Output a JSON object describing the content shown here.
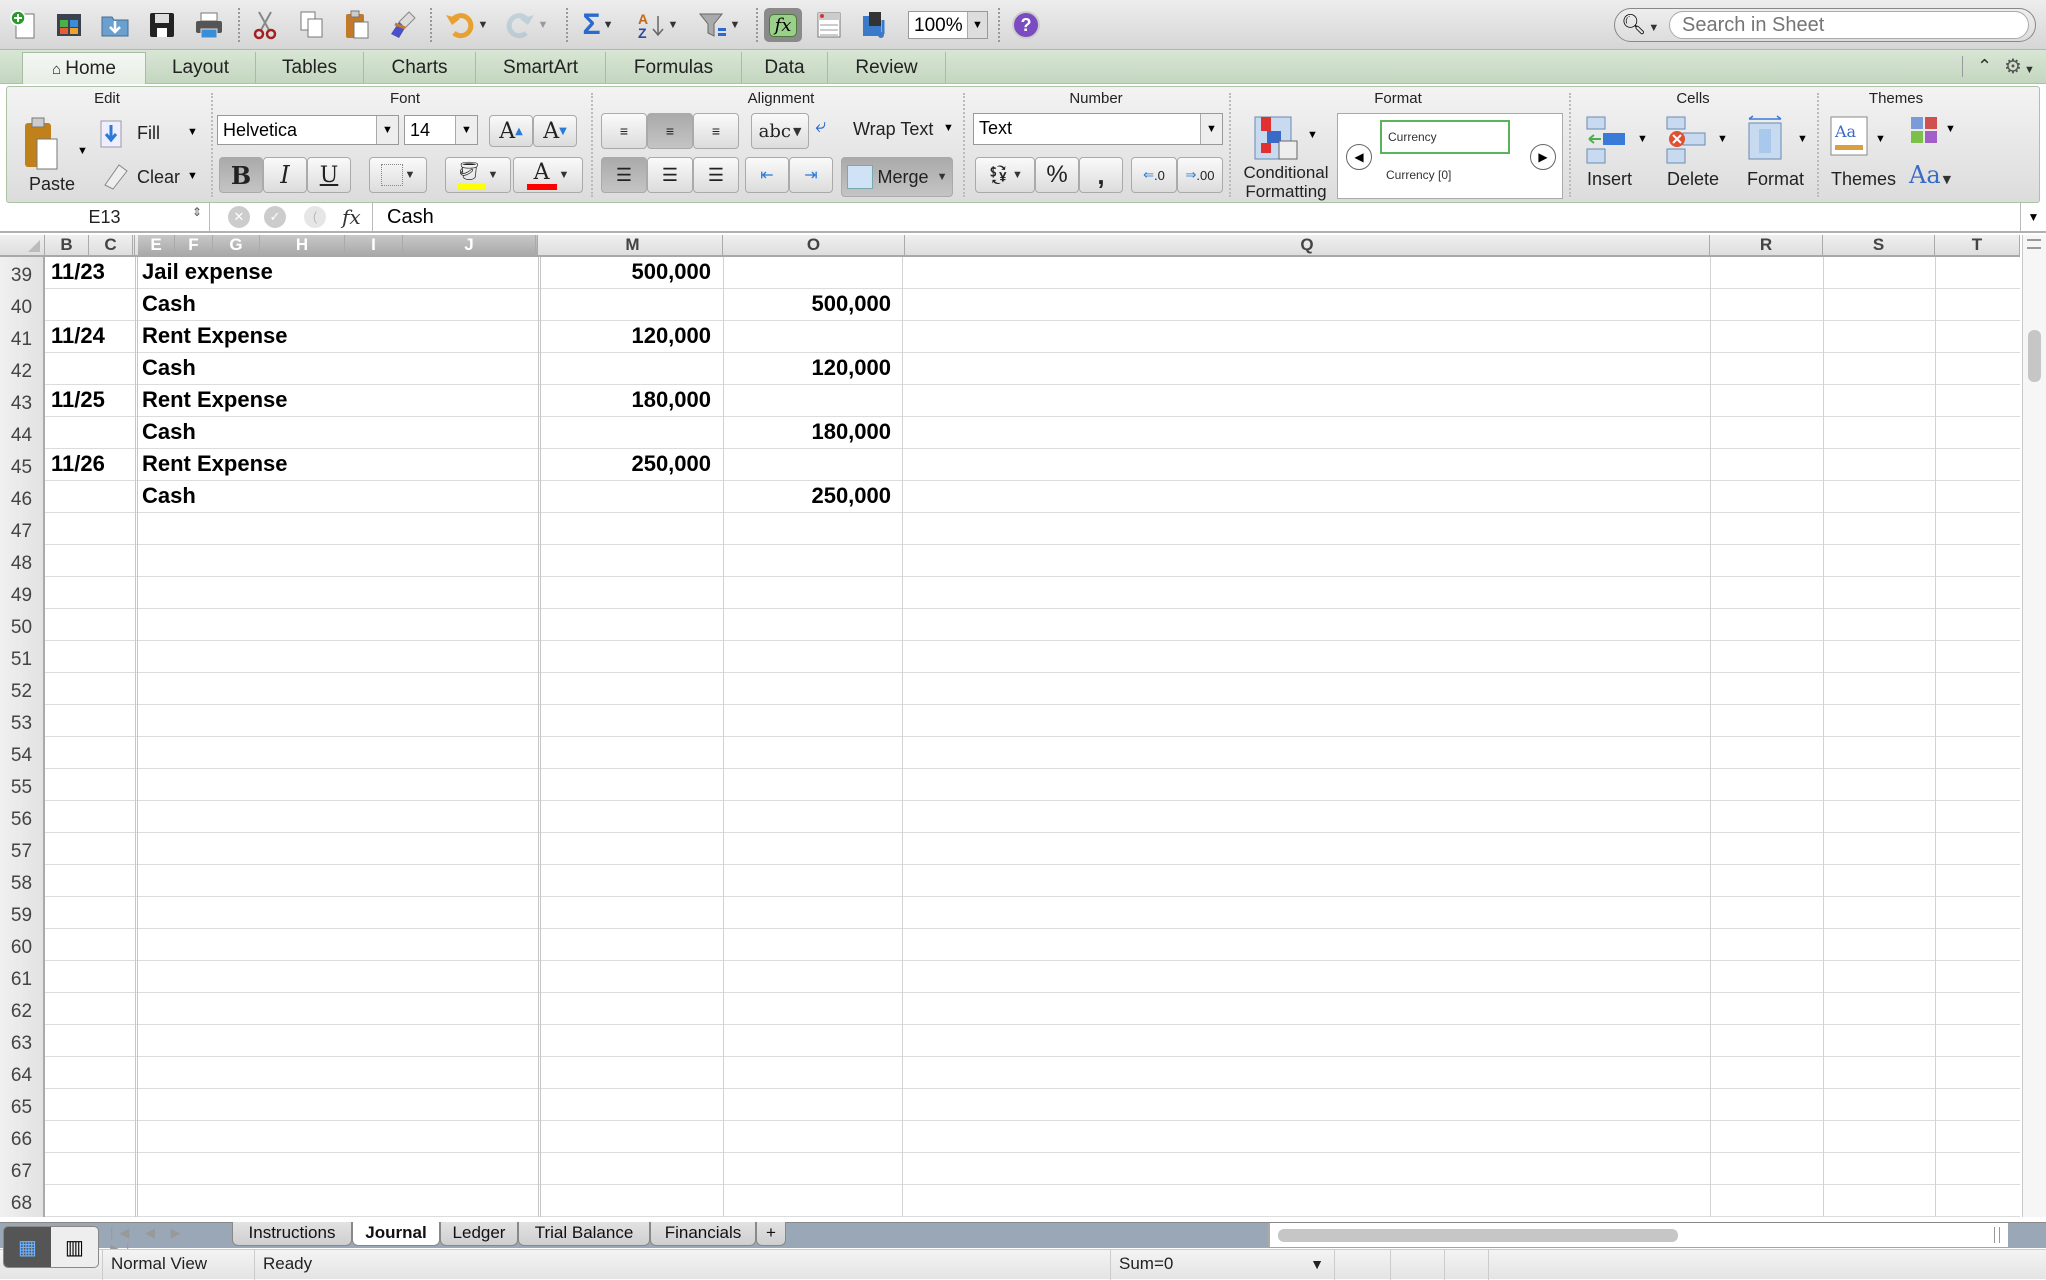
{
  "toolbar": {
    "zoom": "100%",
    "search_placeholder": "Search in Sheet",
    "icons": [
      "new-workbook-icon",
      "gallery-icon",
      "open-icon",
      "save-icon",
      "print-icon",
      "cut-icon",
      "copy-icon",
      "paste-icon",
      "format-painter-icon",
      "undo-icon",
      "redo-icon",
      "autosum-icon",
      "sort-icon",
      "filter-icon",
      "formula-builder-icon",
      "toolbox-icon",
      "media-browser-icon",
      "help-icon"
    ]
  },
  "ribbon_tabs": [
    {
      "label": "Home",
      "active": true
    },
    {
      "label": "Layout"
    },
    {
      "label": "Tables"
    },
    {
      "label": "Charts"
    },
    {
      "label": "SmartArt"
    },
    {
      "label": "Formulas"
    },
    {
      "label": "Data"
    },
    {
      "label": "Review"
    }
  ],
  "ribbon": {
    "groups": {
      "edit": "Edit",
      "font": "Font",
      "alignment": "Alignment",
      "number": "Number",
      "format": "Format",
      "cells": "Cells",
      "themes": "Themes"
    },
    "edit": {
      "paste": "Paste",
      "fill": "Fill",
      "clear": "Clear"
    },
    "font": {
      "name": "Helvetica",
      "size": "14",
      "bold": "B",
      "italic": "I",
      "underline": "U",
      "grow": "A",
      "shrink": "A",
      "fill_color": "#ffff00",
      "font_color": "#ff0000"
    },
    "alignment": {
      "orientation": "abc",
      "wrap_text": "Wrap Text",
      "merge": "Merge"
    },
    "number": {
      "format": "Text",
      "percent": "%",
      "comma": ",",
      "inc_decimal": ".0",
      "dec_decimal": ".00"
    },
    "format": {
      "conditional": "Conditional Formatting",
      "styles": [
        "Currency",
        "Currency [0]"
      ]
    },
    "cells": {
      "insert": "Insert",
      "delete": "Delete",
      "format": "Format"
    },
    "themes": {
      "themes": "Themes",
      "fonts": "Aa"
    }
  },
  "formula_bar": {
    "name_box": "E13",
    "fx": "fx",
    "value": "Cash"
  },
  "columns": [
    "B",
    "C",
    "E",
    "F",
    "G",
    "H",
    "I",
    "J",
    "M",
    "O",
    "Q",
    "R",
    "S",
    "T"
  ],
  "rows": [
    {
      "n": "39",
      "date": "11/23",
      "account": "Jail expense",
      "debit": "500,000",
      "credit": ""
    },
    {
      "n": "40",
      "date": "",
      "account": "Cash",
      "debit": "",
      "credit": "500,000"
    },
    {
      "n": "41",
      "date": "11/24",
      "account": "Rent Expense",
      "debit": "120,000",
      "credit": ""
    },
    {
      "n": "42",
      "date": "",
      "account": "Cash",
      "debit": "",
      "credit": "120,000"
    },
    {
      "n": "43",
      "date": "11/25",
      "account": "Rent Expense",
      "debit": "180,000",
      "credit": ""
    },
    {
      "n": "44",
      "date": "",
      "account": "Cash",
      "debit": "",
      "credit": "180,000"
    },
    {
      "n": "45",
      "date": "11/26",
      "account": "Rent Expense",
      "debit": "250,000",
      "credit": ""
    },
    {
      "n": "46",
      "date": "",
      "account": "Cash",
      "debit": "",
      "credit": "250,000"
    },
    {
      "n": "47"
    },
    {
      "n": "48"
    },
    {
      "n": "49"
    },
    {
      "n": "50"
    },
    {
      "n": "51"
    },
    {
      "n": "52"
    },
    {
      "n": "53"
    },
    {
      "n": "54"
    },
    {
      "n": "55"
    },
    {
      "n": "56"
    },
    {
      "n": "57"
    },
    {
      "n": "58"
    },
    {
      "n": "59"
    },
    {
      "n": "60"
    },
    {
      "n": "61"
    },
    {
      "n": "62"
    },
    {
      "n": "63"
    },
    {
      "n": "64"
    },
    {
      "n": "65"
    },
    {
      "n": "66"
    },
    {
      "n": "67"
    },
    {
      "n": "68"
    }
  ],
  "sheets": [
    {
      "label": "Instructions"
    },
    {
      "label": "Journal",
      "active": true
    },
    {
      "label": "Ledger"
    },
    {
      "label": "Trial Balance"
    },
    {
      "label": "Financials"
    },
    {
      "label": "+"
    }
  ],
  "status": {
    "view": "Normal View",
    "state": "Ready",
    "sum": "Sum=0"
  }
}
